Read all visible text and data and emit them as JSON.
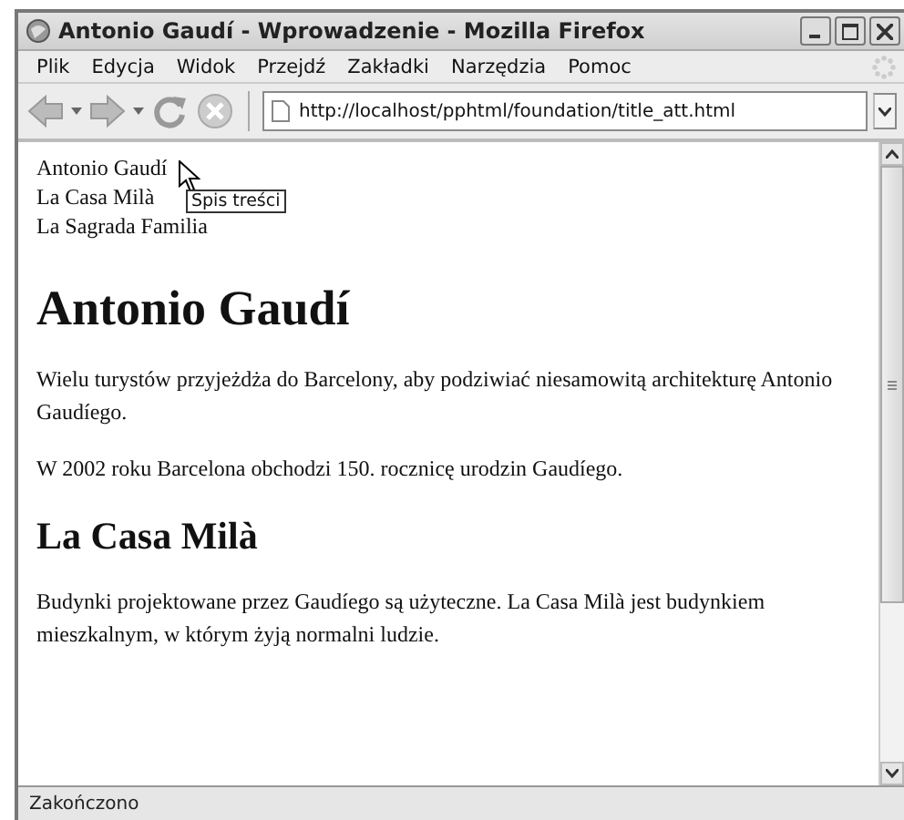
{
  "window": {
    "title": "Antonio Gaudí - Wprowadzenie - Mozilla Firefox"
  },
  "menu": [
    "Plik",
    "Edycja",
    "Widok",
    "Przejdź",
    "Zakładki",
    "Narzędzia",
    "Pomoc"
  ],
  "address_bar": {
    "value": "http://localhost/pphtml/foundation/title_att.html"
  },
  "page": {
    "links": [
      "Antonio Gaudí",
      "La Casa Milà",
      "La Sagrada Familia"
    ],
    "tooltip": "Spis treści",
    "blocks": [
      {
        "kind": "h1",
        "text": "Antonio Gaudí"
      },
      {
        "kind": "p",
        "text": "Wielu turystów przyjeżdża do Barcelony, aby podziwiać niesamowitą architekturę Antonio Gaudíego."
      },
      {
        "kind": "p",
        "text": "W 2002 roku Barcelona obchodzi 150. rocznicę urodzin Gaudíego."
      },
      {
        "kind": "h2",
        "text": "La Casa Milà"
      },
      {
        "kind": "p",
        "text": "Budynki projektowane przez Gaudíego są użyteczne. La Casa Milà jest budynkiem mieszkalnym, w którym żyją normalni ludzie."
      }
    ]
  },
  "status_bar": {
    "text": "Zakończono"
  }
}
